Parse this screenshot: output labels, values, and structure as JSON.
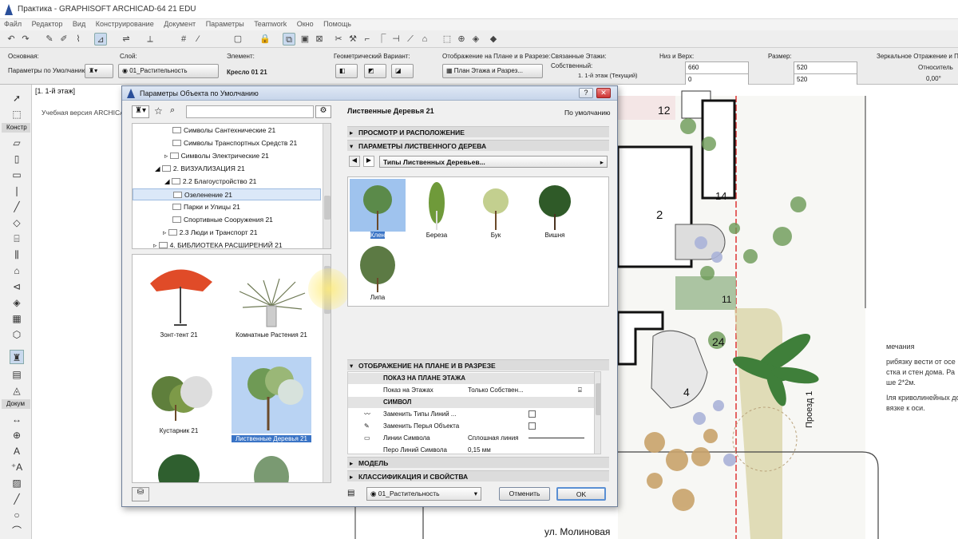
{
  "app": {
    "title": "Практика - GRAPHISOFT ARCHICAD-64 21 EDU"
  },
  "menu": [
    "Файл",
    "Редактор",
    "Вид",
    "Конструирование",
    "Документ",
    "Параметры",
    "Teamwork",
    "Окно",
    "Помощь"
  ],
  "infobox": {
    "basic_label": "Основная:",
    "default_params": "Параметры по Умолчанию",
    "layer_label": "Слой:",
    "layer_value": "01_Растительность",
    "element_label": "Элемент:",
    "element_value": "Кресло 01 21",
    "geom_label": "Геометрический Вариант:",
    "display_label": "Отображение на Плане и в Разрезе:",
    "display_value": "План Этажа и Разрез...",
    "linked_label": "Связанные Этажи:",
    "own_label": "Собственный:",
    "own_value": "1. 1-й этаж (Текущий)",
    "bottom_top_label": "Низ и Верх:",
    "top_value": "660",
    "bottom_value": "0",
    "size_label": "Размер:",
    "size_a": "520",
    "size_b": "520",
    "mirror_label": "Зеркальное Отражение и Поворот:",
    "relative_label": "Относитель",
    "angle_value": "0,00°"
  },
  "toolbox": {
    "construct": "Констр",
    "document": "Докум"
  },
  "canvas": {
    "tab_label": "[1. 1-й этаж]",
    "trial_text": "Учебная версия ARCHICAD",
    "street": "ул. Молиновая",
    "passage": "Проезд 1",
    "numbers": [
      "12",
      "14",
      "2",
      "11",
      "24",
      "4"
    ],
    "notes": [
      "мечания",
      "рибязку вести от осе",
      "стка и стен дома. Ра",
      "ше 2*2м.",
      "Iля криволинейных дор",
      "вязке к оси."
    ]
  },
  "dialog": {
    "title": "Параметры Объекта по Умолчанию",
    "search_placeholder": "",
    "tree": [
      {
        "label": "Символы Сантехнические 21",
        "indent": 3
      },
      {
        "label": "Символы Транспортных Средств 21",
        "indent": 3
      },
      {
        "label": "Символы Электрические 21",
        "indent": 3
      },
      {
        "label": "2. ВИЗУАЛИЗАЦИЯ 21",
        "indent": 1
      },
      {
        "label": "2.2 Благоустройство 21",
        "indent": 2
      },
      {
        "label": "Озеленение 21",
        "indent": 3
      },
      {
        "label": "Парки и Улицы 21",
        "indent": 3
      },
      {
        "label": "Спортивные Сооружения 21",
        "indent": 3
      },
      {
        "label": "2.3 Люди и Транспорт 21",
        "indent": 2
      },
      {
        "label": "4. БИБЛИОТЕКА РАСШИРЕНИЙ 21",
        "indent": 1
      }
    ],
    "thumbs": [
      "Зонт-тент 21",
      "Комнатные Растения 21",
      "Кустарник 21",
      "Лиственные Деревья 21"
    ],
    "object_name": "Лиственные Деревья 21",
    "default_label": "По умолчанию",
    "sections": {
      "view": "ПРОСМОТР И РАСПОЛОЖЕНИЕ",
      "params": "ПАРАМЕТРЫ ЛИСТВЕННОГО ДЕРЕВА",
      "display": "ОТОБРАЖЕНИЕ НА ПЛАНЕ И В РАЗРЕЗЕ",
      "model": "МОДЕЛЬ",
      "classification": "КЛАССИФИКАЦИЯ И СВОЙСТВА"
    },
    "tree_types_label": "Типы Лиственных Деревьев...",
    "tree_types": [
      "Клен",
      "Береза",
      "Бук",
      "Вишня",
      "Липа"
    ],
    "props": {
      "plan_header": "ПОКАЗ НА ПЛАНЕ ЭТАЖА",
      "show_on": "Показ на Этажах",
      "show_on_value": "Только Собствен...",
      "symbol_header": "СИМВОЛ",
      "replace_lines": "Заменить Типы Линий ...",
      "replace_pens": "Заменить Перья Объекта",
      "symbol_lines": "Линии Символа",
      "solid_line": "Сплошная линия",
      "pen_partial": "Перо Линий Символа",
      "pen_value": "0,15 мм"
    },
    "footer_layer": "01_Растительность",
    "cancel": "Отменить",
    "ok": "OK"
  }
}
